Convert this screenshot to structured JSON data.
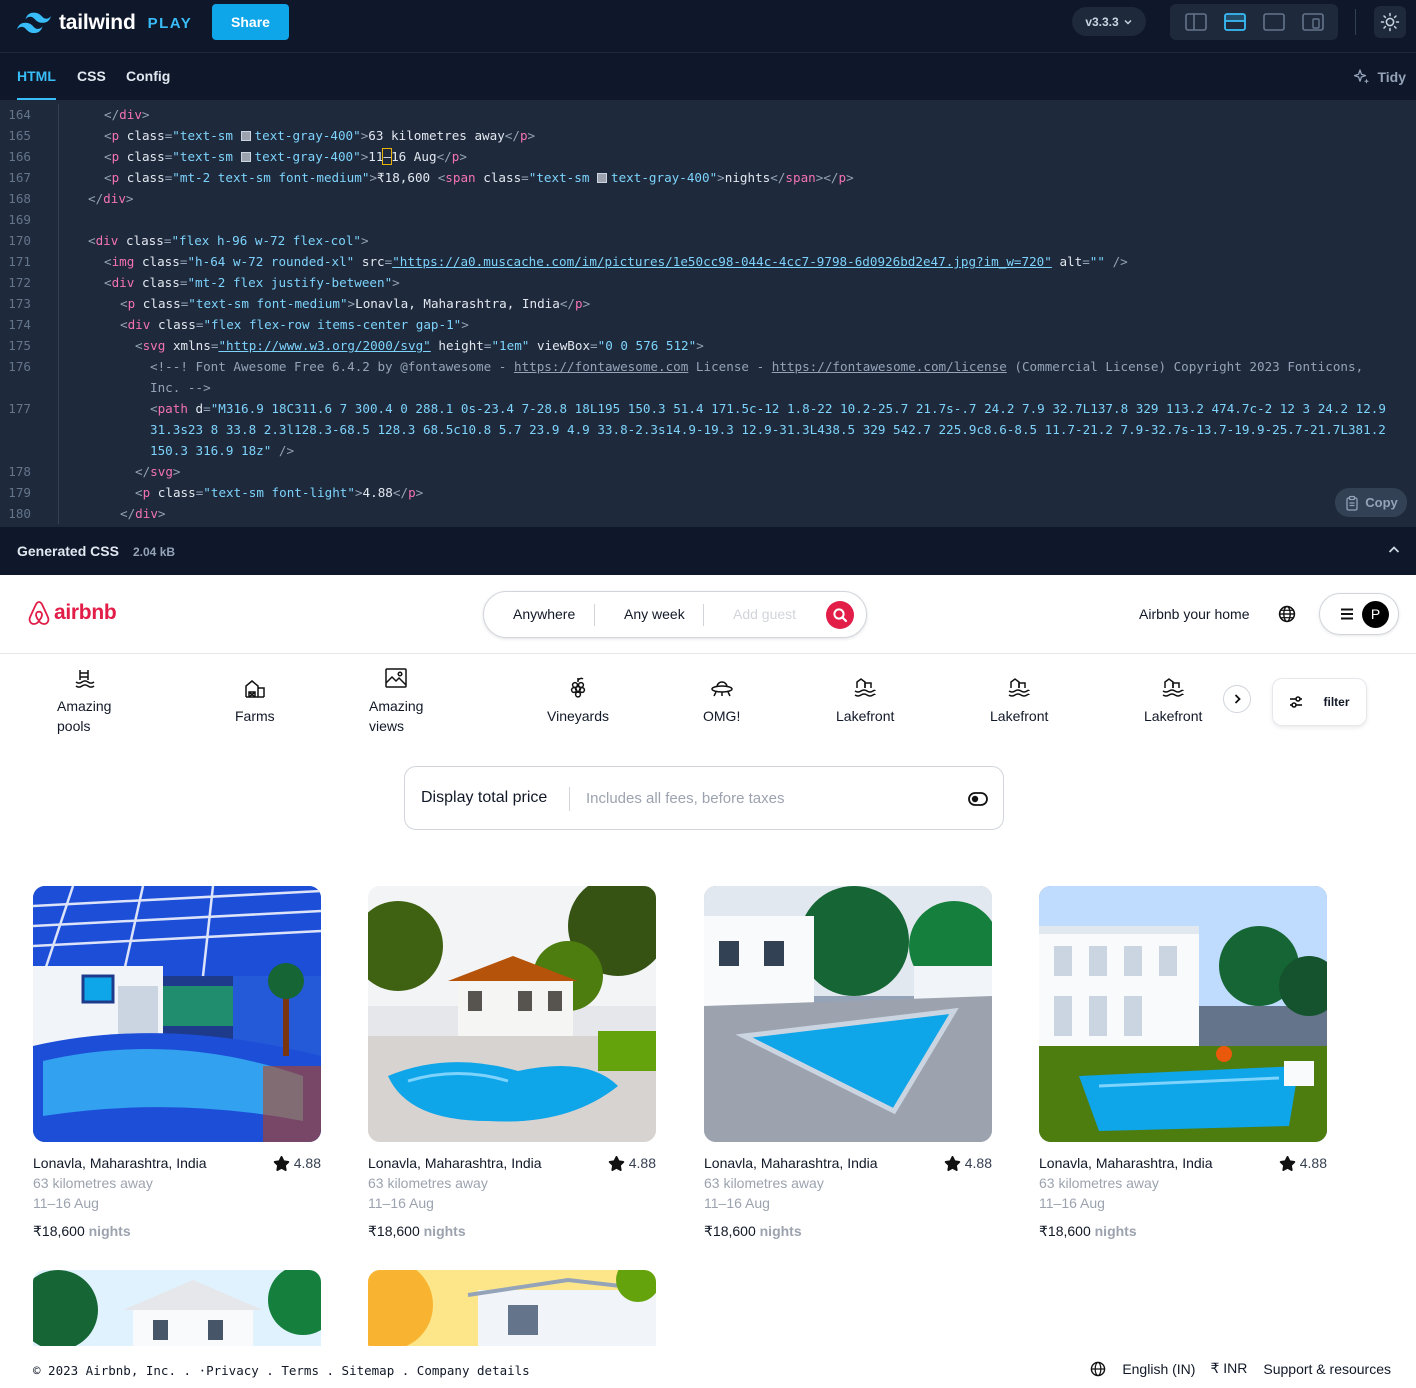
{
  "playground": {
    "brand": "tailwind",
    "brand_suffix": "PLAY",
    "share_label": "Share",
    "version": "v3.3.3",
    "tabs": [
      "HTML",
      "CSS",
      "Config"
    ],
    "active_tab": "HTML",
    "tidy_label": "Tidy",
    "copy_label": "Copy",
    "generated_label": "Generated CSS",
    "generated_size": "2.04 kB",
    "line_numbers": [
      "164",
      "165",
      "166",
      "167",
      "168",
      "169",
      "170",
      "171",
      "172",
      "173",
      "174",
      "175",
      "176",
      "",
      "177",
      "",
      "",
      "178",
      "179",
      "180"
    ]
  },
  "site": {
    "brand": "airbnb",
    "search": {
      "where": "Anywhere",
      "when": "Any week",
      "guest_placeholder": "Add guest"
    },
    "host_label": "Airbnb your home",
    "avatar_letter": "P",
    "categories": [
      {
        "line1": "Amazing",
        "line2": "pools",
        "icon": "pool-icon"
      },
      {
        "line1": "Farms",
        "line2": "",
        "icon": "farm-icon"
      },
      {
        "line1": "Amazing",
        "line2": "views",
        "icon": "mountain-view-icon"
      },
      {
        "line1": "Vineyards",
        "line2": "",
        "icon": "grapes-icon"
      },
      {
        "line1": "OMG!",
        "line2": "",
        "icon": "ufo-icon"
      },
      {
        "line1": "Lakefront",
        "line2": "",
        "icon": "lakefront-icon"
      },
      {
        "line1": "Lakefront",
        "line2": "",
        "icon": "lakefront-icon"
      },
      {
        "line1": "Lakefront",
        "line2": "",
        "icon": "lakefront-icon"
      }
    ],
    "filter_label": "filter",
    "price_toggle": {
      "title": "Display total price",
      "subtitle": "Includes all fees, before taxes"
    },
    "listings": [
      {
        "location": "Lonavla, Maharashtra, India",
        "rating": "4.88",
        "distance": "63 kilometres away",
        "dates": "11–16 Aug",
        "price": "₹18,600",
        "unit": "nights"
      },
      {
        "location": "Lonavla, Maharashtra, India",
        "rating": "4.88",
        "distance": "63 kilometres away",
        "dates": "11–16 Aug",
        "price": "₹18,600",
        "unit": "nights"
      },
      {
        "location": "Lonavla, Maharashtra, India",
        "rating": "4.88",
        "distance": "63 kilometres away",
        "dates": "11–16 Aug",
        "price": "₹18,600",
        "unit": "nights"
      },
      {
        "location": "Lonavla, Maharashtra, India",
        "rating": "4.88",
        "distance": "63 kilometres away",
        "dates": "11–16 Aug",
        "price": "₹18,600",
        "unit": "nights"
      }
    ],
    "footer": {
      "copyright": "© 2023 Airbnb, Inc. . ·Privacy . Terms . Sitemap . Company details",
      "language": "English (IN)",
      "currency": "₹ INR",
      "support": "Support & resources"
    }
  },
  "colors": {
    "sky": "#38bdf8",
    "brand_rose": "#e11d48",
    "editor_bg": "#1e293b",
    "chrome_bg": "#0f172a"
  }
}
